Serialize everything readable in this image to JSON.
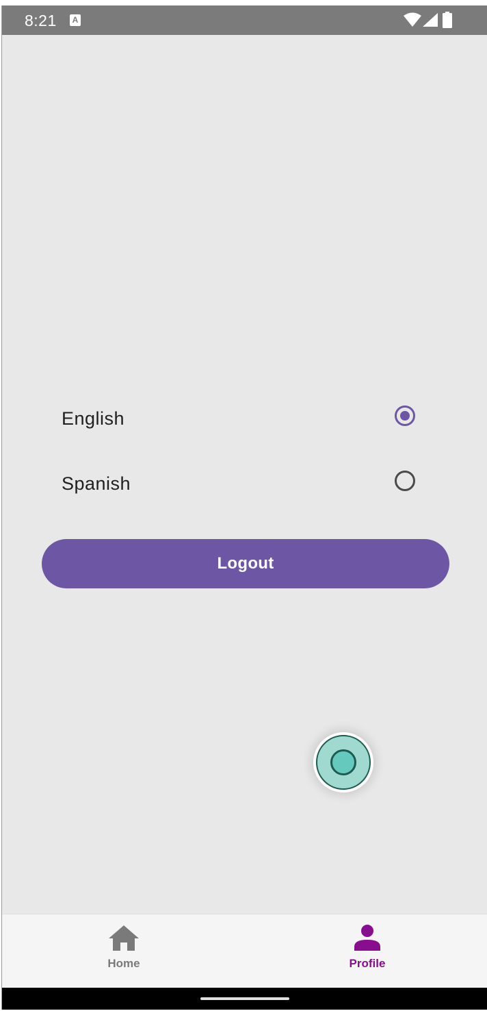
{
  "status_bar": {
    "time": "8:21",
    "notification_icon_letter": "A"
  },
  "language_options": [
    {
      "label": "English",
      "selected": true
    },
    {
      "label": "Spanish",
      "selected": false
    }
  ],
  "logout_label": "Logout",
  "bottom_nav": {
    "items": [
      {
        "label": "Home",
        "icon": "home-icon",
        "active": false
      },
      {
        "label": "Profile",
        "icon": "person-icon",
        "active": true
      }
    ]
  },
  "colors": {
    "accent": "#6d57a5",
    "active_nav": "#880e8f",
    "inactive_nav": "#7a7a7a",
    "background": "#e8e8e8",
    "fab": "#66c9bd"
  }
}
